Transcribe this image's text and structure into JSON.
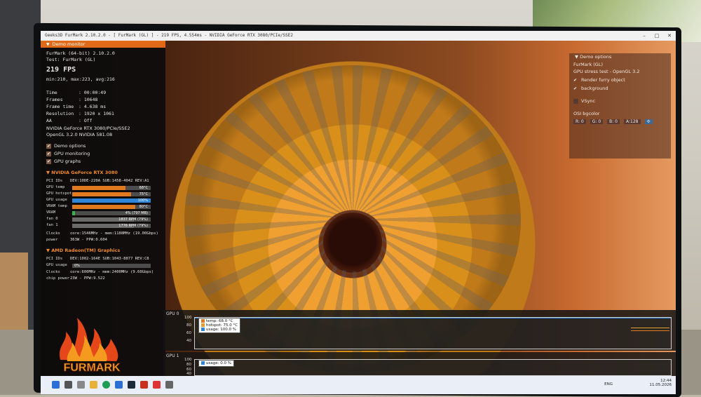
{
  "window": {
    "title": "Geeks3D FurMark 2.10.2.0 - [ FurMark (GL) ] - 219 FPS, 4.554ms - NVIDIA GeForce RTX 3080/PCIe/SSE2"
  },
  "hud": {
    "header": "Demo monitor",
    "app": "FurMark (64-bit) 2.10.2.0",
    "test": "Test: FurMark (GL)",
    "fps": "219 FPS",
    "fps_stats": "min:210, max:223, avg:216",
    "stats": [
      {
        "key": "Time",
        "value": ": 00:00:49"
      },
      {
        "key": "Frames",
        "value": ": 10648"
      },
      {
        "key": "Frame time",
        "value": ": 4.638 ms"
      },
      {
        "key": "Resolution",
        "value": ": 1920 x 1061"
      },
      {
        "key": "AA",
        "value": ": Off"
      }
    ],
    "renderer": "NVIDIA GeForce RTX 3080/PCIe/SSE2",
    "opengl": "OpenGL 3.2.0 NVIDIA 581.08",
    "checks": [
      {
        "label": "Demo options",
        "checked": true
      },
      {
        "label": "GPU monitoring",
        "checked": true
      },
      {
        "label": "GPU graphs",
        "checked": true
      }
    ],
    "gpu0": {
      "title": "NVIDIA GeForce RTX 3080",
      "pci": "DEV:10DE-220A SUB:1458-4042 REV:A1",
      "rows": [
        {
          "key": "PCI IDs",
          "value": ""
        },
        {
          "key": "GPU temp",
          "bar": "68°C",
          "level": 0.68,
          "color": "#e07a1f"
        },
        {
          "key": "GPU hotspot",
          "bar": "75°C",
          "level": 0.75,
          "color": "#e07a1f"
        },
        {
          "key": "GPU usage",
          "bar": "100%",
          "level": 1.0,
          "color": "#2f86d8"
        },
        {
          "key": "VRAM temp",
          "bar": "80°C",
          "level": 0.8,
          "color": "#e07a1f"
        },
        {
          "key": "VRAM",
          "bar": "4% (797 MB)",
          "level": 0.04,
          "color": "#38b24a"
        },
        {
          "key": "fan 0",
          "bar": "1837 RPM (79%)",
          "level": 0.79,
          "color": "#6a6a6a"
        },
        {
          "key": "fan 1",
          "bar": "1776 RPM (79%)",
          "level": 0.79,
          "color": "#6a6a6a"
        }
      ],
      "clocks": "core:1546MHz - mem:1188MHz (19.00Gbps)",
      "power": "363W - PPW:0.604"
    },
    "gpu1": {
      "title": "AMD Radeon(TM) Graphics",
      "pci": "DEV:1002-164E SUB:1043-8877 REV:C8",
      "usage_bar": "0%",
      "usage_level": 0.0,
      "clocks": "core:600MHz - mem:2400MHz (9.60Gbps)",
      "power": "23W - PPW:9.522"
    },
    "labels": {
      "pci": "PCI IDs",
      "gpu_usage": "GPU usage",
      "clocks": "Clocks",
      "power": "power",
      "chip_power": "chip power"
    },
    "logo_text": "FURMARK"
  },
  "options": {
    "header": "Demo options",
    "test": "FurMark (GL)",
    "desc": "GPU stress test - OpenGL 3.2",
    "render_furry": "Render furry object",
    "background": "background",
    "vsync": "VSync",
    "osi_label": "OSI bgcolor",
    "chips": [
      "R: 0",
      "G: 0",
      "B: 0",
      "A:128"
    ]
  },
  "graphs": [
    {
      "title": "GPU 0",
      "yticks": [
        "100",
        "80",
        "60",
        "40"
      ],
      "legend": [
        {
          "label": "temp: 68.0 °C",
          "color": "#e07a1f"
        },
        {
          "label": "hotspot: 75.0 °C",
          "color": "#e0a030"
        },
        {
          "label": "usage: 100.0 %",
          "color": "#2f86d8"
        }
      ]
    },
    {
      "title": "GPU 1",
      "yticks": [
        "100",
        "80",
        "60",
        "40"
      ],
      "legend": [
        {
          "label": "usage: 0.0 %",
          "color": "#2f86d8"
        }
      ]
    }
  ],
  "taskbar": {
    "lang": "ENG",
    "time": "12:44",
    "date": "11.05.2026"
  }
}
